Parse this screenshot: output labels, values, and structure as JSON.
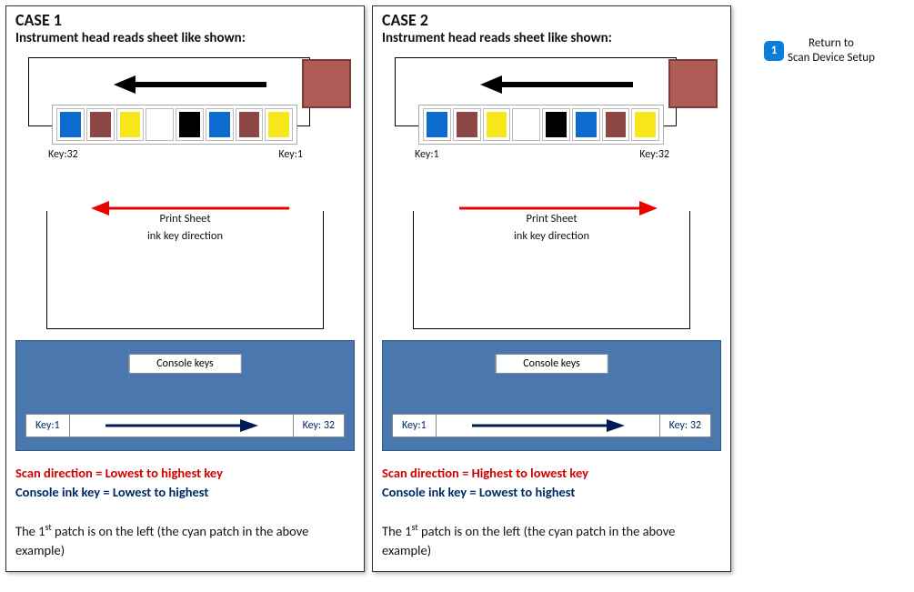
{
  "cases": [
    {
      "title": "CASE 1",
      "subtitle": "Instrument head reads sheet like shown:",
      "top_key_left": "Key:32",
      "top_key_right": "Key:1",
      "red_arrow_dir": "left",
      "print_sheet_line1": "Print Sheet",
      "print_sheet_line2": "ink key direction",
      "console_title": "Console keys",
      "console_key_left": "Key:1",
      "console_key_right": "Key: 32",
      "scan_dir_text": "Scan direction = Lowest to highest key",
      "console_dir_text": "Console ink key = Lowest to highest",
      "patch_note_prefix": "The 1",
      "patch_note_sup": "st",
      "patch_note_rest": " patch is on the left (the cyan patch in the above example)"
    },
    {
      "title": "CASE 2",
      "subtitle": "Instrument head reads sheet like shown:",
      "top_key_left": "Key:1",
      "top_key_right": "Key:32",
      "red_arrow_dir": "right",
      "print_sheet_line1": "Print Sheet",
      "print_sheet_line2": "ink key direction",
      "console_title": "Console keys",
      "console_key_left": "Key:1",
      "console_key_right": "Key: 32",
      "scan_dir_text": "Scan direction = Highest to lowest key",
      "console_dir_text": "Console ink key = Lowest to highest",
      "patch_note_prefix": "The 1",
      "patch_note_sup": "st",
      "patch_note_rest": " patch is on the left (the cyan patch in the above example)"
    }
  ],
  "patch_colors": [
    "cyan",
    "brown",
    "yellow",
    "blank",
    "black",
    "cyan",
    "brown",
    "yellow"
  ],
  "return_link": {
    "badge": "1",
    "line1": "Return to",
    "line2": "Scan Device Setup"
  }
}
